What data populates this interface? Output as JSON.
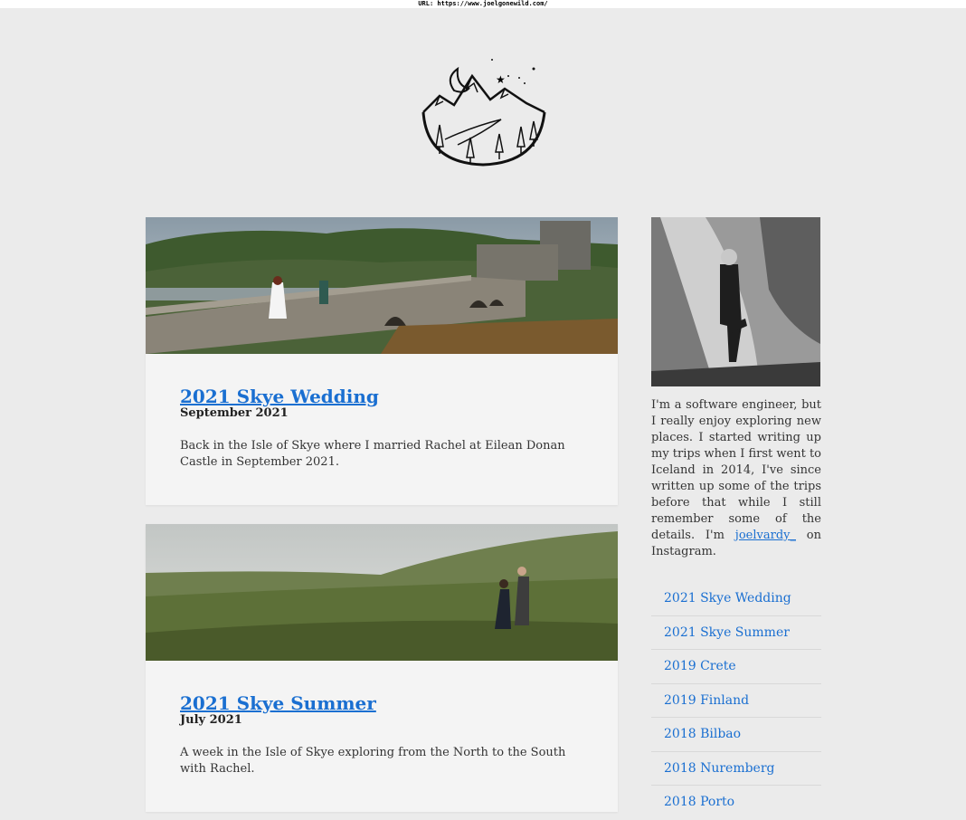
{
  "url_bar": {
    "text": "URL: https://www.joelgonewild.com/"
  },
  "logo": {
    "icon": "mountain-moon-logo-icon"
  },
  "posts": [
    {
      "title": "2021 Skye Wedding",
      "date": "September 2021",
      "excerpt": "Back in the Isle of Skye where I married Rachel at Eilean Donan Castle in September 2021."
    },
    {
      "title": "2021 Skye Summer",
      "date": "July 2021",
      "excerpt": "A week in the Isle of Skye exploring from the North to the South with Rachel."
    }
  ],
  "sidebar": {
    "bio_text": "I'm a software engineer, but I really enjoy exploring new places. I started writing up my trips when I first went to Iceland in 2014, I've since written up some of the trips before that while I still remember some of the details. I'm",
    "instagram_handle": "joelvardy_",
    "bio_suffix": " on Instagram.",
    "links": [
      "2021 Skye Wedding",
      "2021 Skye Summer",
      "2019 Crete",
      "2019 Finland",
      "2018 Bilbao",
      "2018 Nuremberg",
      "2018 Porto"
    ]
  },
  "colors": {
    "link": "#1a6fd1",
    "background": "#ebebeb",
    "card": "#f4f4f4"
  }
}
